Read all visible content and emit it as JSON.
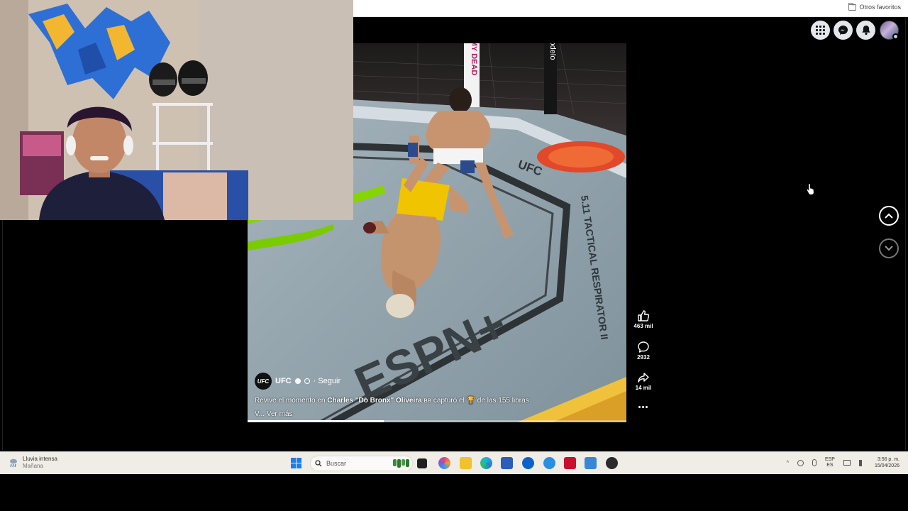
{
  "browser": {
    "favorites_bar": {
      "other_favorites": "Otros favoritos"
    },
    "top_buttons": [
      "apps-grid-icon",
      "messenger-icon",
      "notifications-bell-icon",
      "profile-avatar"
    ]
  },
  "reel": {
    "account_name": "UFC",
    "logo_text": "UFC",
    "follow_label": "· Seguir",
    "desc_prefix": "Revive el momento en",
    "desc_name": "Charles \"Do Bronx\" Oliveira",
    "desc_suffix": "вв capturó el 🏆 de las 155 libras",
    "desc_more_prefix": "V...",
    "see_more": "Ver más",
    "progress": 0.36,
    "arena_texts": {
      "espn": "ESPN+",
      "ufc": "UFC",
      "tactical": "5.11 TACTICAL RESPIRATOR II",
      "banner": "MY DEAD",
      "edelo": "odelo"
    }
  },
  "actions": {
    "likes": "463 mil",
    "comments": "2932",
    "shares": "14 mil"
  },
  "navigation": {
    "up": "chevron-up-icon",
    "down": "chevron-down-icon"
  },
  "taskbar": {
    "weather_title": "Lluvia intensa",
    "weather_sub": "Mañana",
    "search_placeholder": "Buscar",
    "lang_top": "ESP",
    "lang_bottom": "ES",
    "time": "3:56 p. m.",
    "date": "15/04/2026"
  },
  "colors": {
    "accent": "#1877f2",
    "fb_button": "#e4e6eb",
    "windows_blue": "#1c7ee8"
  }
}
